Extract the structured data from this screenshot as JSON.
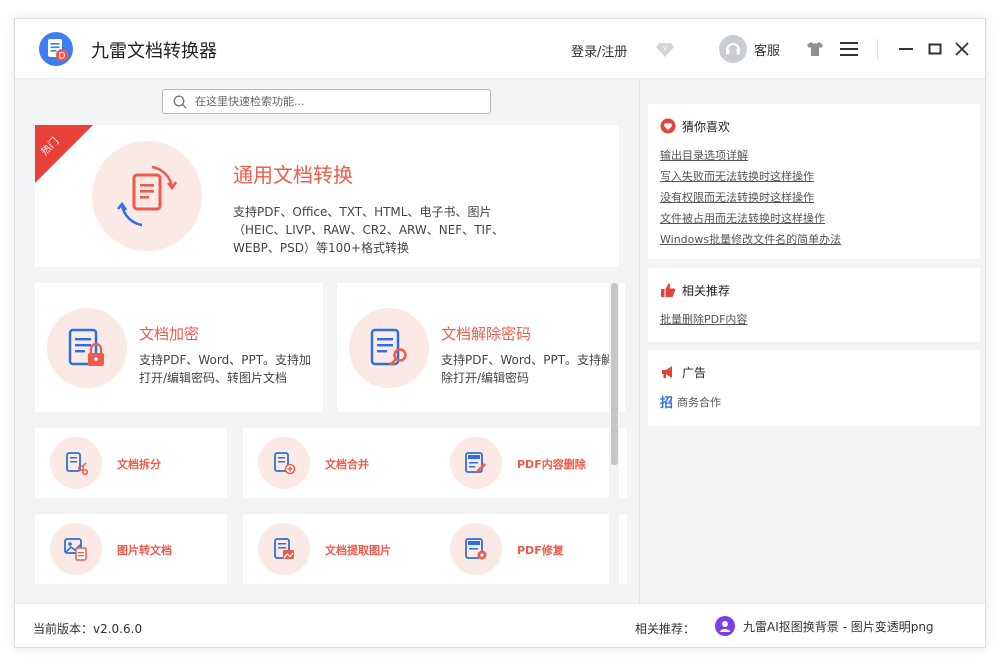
{
  "app": {
    "title": "九雷文档转换器"
  },
  "header": {
    "login_label": "登录/注册",
    "service_label": "客服"
  },
  "search": {
    "placeholder": "在这里快速检索功能..."
  },
  "hero": {
    "badge": "热门",
    "title": "通用文档转换",
    "desc_line1": "支持PDF、Office、TXT、HTML、电子书、图片",
    "desc_line2": "（HEIC、LIVP、RAW、CR2、ARW、NEF、TIF、",
    "desc_line3": "WEBP、PSD）等100+格式转换"
  },
  "cards": {
    "encrypt": {
      "title": "文档加密",
      "desc": "支持PDF、Word、PPT。支持加打开/编辑密码、转图片文档"
    },
    "decrypt": {
      "title": "文档解除密码",
      "desc": "支持PDF、Word、PPT。支持解除打开/编辑密码"
    }
  },
  "tools": [
    {
      "label": "文档拆分"
    },
    {
      "label": "文档合并"
    },
    {
      "label": "PDF内容删除"
    },
    {
      "label": "图片转文档"
    },
    {
      "label": "文档提取图片"
    },
    {
      "label": "PDF修复"
    }
  ],
  "sidebar": {
    "guess": {
      "title": "猜你喜欢",
      "links": [
        "输出目录选项详解",
        "写入失败而无法转换时这样操作",
        "没有权限而无法转换时这样操作",
        "文件被占用而无法转换时这样操作",
        "Windows批量修改文件名的简单办法"
      ]
    },
    "related": {
      "title": "相关推荐",
      "links": [
        "批量删除PDF内容"
      ]
    },
    "ads": {
      "title": "广告",
      "zhao": "招",
      "text": "商务合作"
    }
  },
  "footer": {
    "version": "当前版本：v2.0.6.0",
    "related_label": "相关推荐：",
    "related_item": "九雷AI抠图换背景 - 图片变透明png"
  },
  "colors": {
    "accent": "#ef5a4a",
    "hot_ribbon": "#e8413a",
    "circle_bg": "#fbe9e5",
    "icon_blue": "#2b6fe0"
  }
}
